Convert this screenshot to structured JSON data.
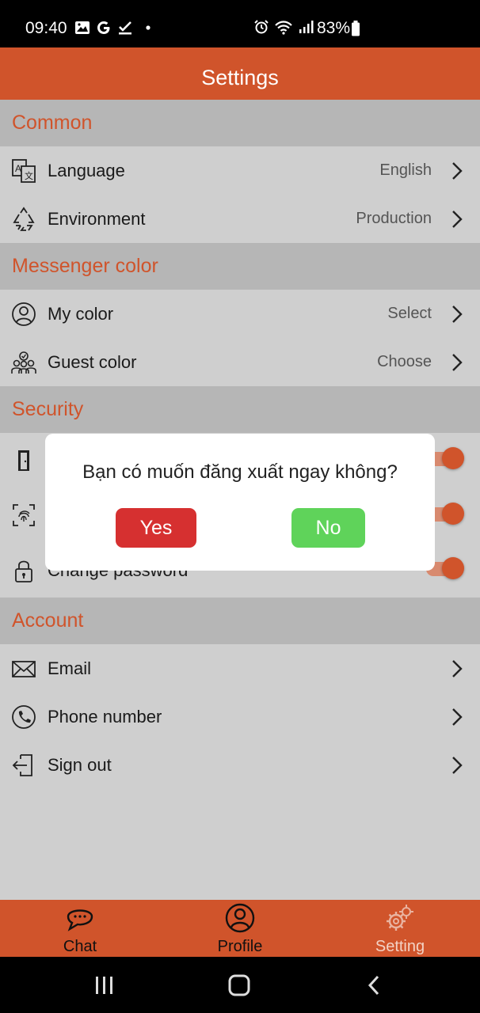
{
  "status_bar": {
    "time": "09:40",
    "battery": "83%",
    "icons": [
      "image-icon",
      "google-icon",
      "task-icon",
      "dot-icon",
      "alarm-icon",
      "wifi-icon",
      "signal-icon",
      "battery-icon"
    ]
  },
  "header": {
    "title": "Settings"
  },
  "sections": {
    "common": {
      "title": "Common",
      "language": {
        "label": "Language",
        "value": "English"
      },
      "environment": {
        "label": "Environment",
        "value": "Production"
      }
    },
    "messenger": {
      "title": "Messenger color",
      "my_color": {
        "label": "My color",
        "value": "Select"
      },
      "guest_color": {
        "label": "Guest color",
        "value": "Choose"
      }
    },
    "security": {
      "title": "Security",
      "change_password": {
        "label": "Change password"
      }
    },
    "account": {
      "title": "Account",
      "email": {
        "label": "Email"
      },
      "phone": {
        "label": "Phone number"
      },
      "sign_out": {
        "label": "Sign out"
      }
    }
  },
  "dialog": {
    "message": "Bạn có muốn đăng xuất ngay không?",
    "yes": "Yes",
    "no": "No"
  },
  "bottom_nav": {
    "chat": "Chat",
    "profile": "Profile",
    "setting": "Setting"
  },
  "colors": {
    "accent": "#d0542b",
    "section_bg": "#b6b6b6",
    "row_bg": "#cfcfcf",
    "yes_button": "#d63030",
    "no_button": "#5fd35a"
  }
}
